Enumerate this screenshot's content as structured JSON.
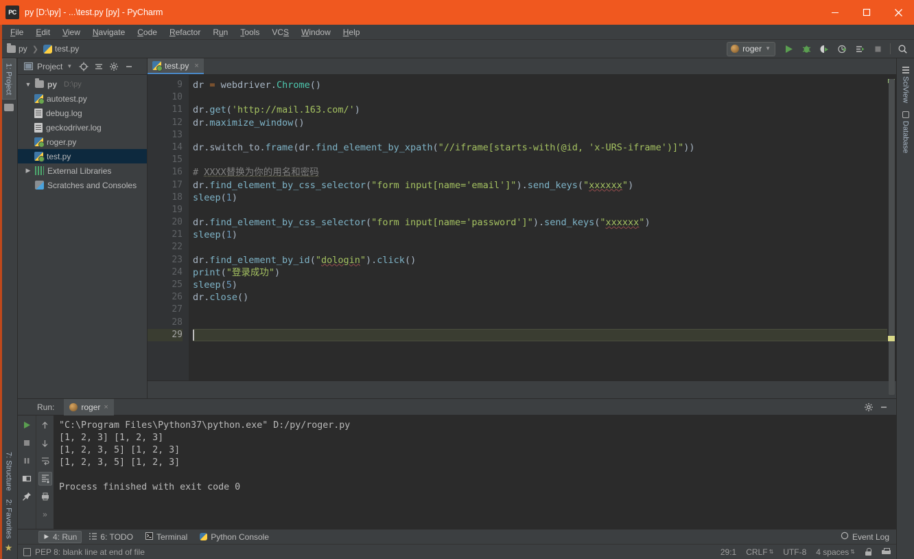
{
  "window": {
    "title": "py [D:\\py] - ...\\test.py [py] - PyCharm",
    "logo_text": "PC",
    "controls": {
      "minimize": "minimize-icon",
      "maximize": "maximize-icon",
      "close": "close-icon"
    }
  },
  "menubar": {
    "items": [
      "File",
      "Edit",
      "View",
      "Navigate",
      "Code",
      "Refactor",
      "Run",
      "Tools",
      "VCS",
      "Window",
      "Help"
    ]
  },
  "navbar": {
    "breadcrumb": [
      "py",
      "test.py"
    ],
    "run_config": "roger",
    "buttons": [
      "run-button",
      "debug-button",
      "run-coverage-button",
      "profile-button",
      "run-anything-button",
      "stop-button",
      "search-everywhere-button"
    ]
  },
  "left_rail": {
    "top": "1: Project",
    "bottom": [
      "7: Structure",
      "2: Favorites"
    ]
  },
  "right_rail": {
    "items": [
      "SciView",
      "Database"
    ]
  },
  "project_panel": {
    "title": "Project",
    "header_icons": [
      "locate-icon",
      "collapse-all-icon",
      "settings-icon",
      "hide-icon"
    ],
    "tree": [
      {
        "label": "py",
        "path": "D:\\py",
        "icon": "folder-icon",
        "twisty": "▼",
        "depth": 0,
        "selected": false
      },
      {
        "label": "autotest.py",
        "path": "",
        "icon": "python-file-icon",
        "twisty": "",
        "depth": 1,
        "selected": false
      },
      {
        "label": "debug.log",
        "path": "",
        "icon": "log-file-icon",
        "twisty": "",
        "depth": 1,
        "selected": false
      },
      {
        "label": "geckodriver.log",
        "path": "",
        "icon": "log-file-icon",
        "twisty": "",
        "depth": 1,
        "selected": false
      },
      {
        "label": "roger.py",
        "path": "",
        "icon": "python-file-icon",
        "twisty": "",
        "depth": 1,
        "selected": false
      },
      {
        "label": "test.py",
        "path": "",
        "icon": "python-file-icon",
        "twisty": "",
        "depth": 1,
        "selected": true
      },
      {
        "label": "External Libraries",
        "path": "",
        "icon": "libraries-icon",
        "twisty": "▶",
        "depth": 0,
        "selected": false
      },
      {
        "label": "Scratches and Consoles",
        "path": "",
        "icon": "scratches-icon",
        "twisty": "",
        "depth": 0,
        "selected": false
      }
    ]
  },
  "editor": {
    "tab": {
      "label": "test.py",
      "close": "×"
    },
    "first_line_number": 9,
    "caret_line": 29,
    "lines": [
      {
        "n": 9,
        "tokens": [
          {
            "t": "dr ",
            "c": "k-id"
          },
          {
            "t": "=",
            "c": "k-kw"
          },
          {
            "t": " webdriver.",
            "c": "k-id"
          },
          {
            "t": "Chrome",
            "c": "k-cls"
          },
          {
            "t": "()",
            "c": "k-op"
          }
        ]
      },
      {
        "n": 10,
        "tokens": []
      },
      {
        "n": 11,
        "tokens": [
          {
            "t": "dr.",
            "c": "k-id"
          },
          {
            "t": "get",
            "c": "k-fncall"
          },
          {
            "t": "(",
            "c": "k-op"
          },
          {
            "t": "'http://mail.163.com/'",
            "c": "k-str"
          },
          {
            "t": ")",
            "c": "k-op"
          }
        ]
      },
      {
        "n": 12,
        "tokens": [
          {
            "t": "dr.",
            "c": "k-id"
          },
          {
            "t": "maximize_window",
            "c": "k-fncall"
          },
          {
            "t": "()",
            "c": "k-op"
          }
        ]
      },
      {
        "n": 13,
        "tokens": []
      },
      {
        "n": 14,
        "tokens": [
          {
            "t": "dr.switch_to.",
            "c": "k-id"
          },
          {
            "t": "frame",
            "c": "k-fncall"
          },
          {
            "t": "(dr.",
            "c": "k-op"
          },
          {
            "t": "find_element_by_xpath",
            "c": "k-fncall"
          },
          {
            "t": "(",
            "c": "k-op"
          },
          {
            "t": "\"//iframe[starts-with(@id, 'x-URS-iframe')]\"",
            "c": "k-str"
          },
          {
            "t": "))",
            "c": "k-op"
          }
        ]
      },
      {
        "n": 15,
        "tokens": []
      },
      {
        "n": 16,
        "tokens": [
          {
            "t": "# ",
            "c": "k-cmt"
          },
          {
            "t": "XXXX替换为你的用名和密码",
            "c": "k-cmt cm-underline"
          }
        ]
      },
      {
        "n": 17,
        "tokens": [
          {
            "t": "dr.",
            "c": "k-id"
          },
          {
            "t": "find_element_by_css_selector",
            "c": "k-fncall"
          },
          {
            "t": "(",
            "c": "k-op"
          },
          {
            "t": "\"form input[name='email']\"",
            "c": "k-str"
          },
          {
            "t": ").",
            "c": "k-op"
          },
          {
            "t": "send_keys",
            "c": "k-fncall"
          },
          {
            "t": "(",
            "c": "k-op"
          },
          {
            "t": "\"",
            "c": "k-str"
          },
          {
            "t": "xxxxxx",
            "c": "k-str sp"
          },
          {
            "t": "\"",
            "c": "k-str"
          },
          {
            "t": ")",
            "c": "k-op"
          }
        ]
      },
      {
        "n": 18,
        "tokens": [
          {
            "t": "sleep",
            "c": "k-fncall"
          },
          {
            "t": "(",
            "c": "k-op"
          },
          {
            "t": "1",
            "c": "k-num"
          },
          {
            "t": ")",
            "c": "k-op"
          }
        ]
      },
      {
        "n": 19,
        "tokens": []
      },
      {
        "n": 20,
        "tokens": [
          {
            "t": "dr.",
            "c": "k-id"
          },
          {
            "t": "find_element_by_css_selector",
            "c": "k-fncall"
          },
          {
            "t": "(",
            "c": "k-op"
          },
          {
            "t": "\"form input[name='password']\"",
            "c": "k-str"
          },
          {
            "t": ").",
            "c": "k-op"
          },
          {
            "t": "send_keys",
            "c": "k-fncall"
          },
          {
            "t": "(",
            "c": "k-op"
          },
          {
            "t": "\"",
            "c": "k-str"
          },
          {
            "t": "xxxxxx",
            "c": "k-str sp"
          },
          {
            "t": "\"",
            "c": "k-str"
          },
          {
            "t": ")",
            "c": "k-op"
          }
        ]
      },
      {
        "n": 21,
        "tokens": [
          {
            "t": "sleep",
            "c": "k-fncall"
          },
          {
            "t": "(",
            "c": "k-op"
          },
          {
            "t": "1",
            "c": "k-num"
          },
          {
            "t": ")",
            "c": "k-op"
          }
        ]
      },
      {
        "n": 22,
        "tokens": []
      },
      {
        "n": 23,
        "tokens": [
          {
            "t": "dr.",
            "c": "k-id"
          },
          {
            "t": "find_element_by_id",
            "c": "k-fncall"
          },
          {
            "t": "(",
            "c": "k-op"
          },
          {
            "t": "\"",
            "c": "k-str"
          },
          {
            "t": "dologin",
            "c": "k-str sp"
          },
          {
            "t": "\"",
            "c": "k-str"
          },
          {
            "t": ").",
            "c": "k-op"
          },
          {
            "t": "click",
            "c": "k-fncall"
          },
          {
            "t": "()",
            "c": "k-op"
          }
        ]
      },
      {
        "n": 24,
        "tokens": [
          {
            "t": "print",
            "c": "k-fncall"
          },
          {
            "t": "(",
            "c": "k-op"
          },
          {
            "t": "\"登录成功\"",
            "c": "k-str"
          },
          {
            "t": ")",
            "c": "k-op"
          }
        ]
      },
      {
        "n": 25,
        "tokens": [
          {
            "t": "sleep",
            "c": "k-fncall"
          },
          {
            "t": "(",
            "c": "k-op"
          },
          {
            "t": "5",
            "c": "k-num"
          },
          {
            "t": ")",
            "c": "k-op"
          }
        ]
      },
      {
        "n": 26,
        "tokens": [
          {
            "t": "dr.",
            "c": "k-id"
          },
          {
            "t": "close",
            "c": "k-fncall"
          },
          {
            "t": "()",
            "c": "k-op"
          }
        ]
      },
      {
        "n": 27,
        "tokens": []
      },
      {
        "n": 28,
        "tokens": []
      },
      {
        "n": 29,
        "tokens": []
      }
    ]
  },
  "run_window": {
    "label": "Run:",
    "tab": "roger",
    "tab_close": "×",
    "header_icons": [
      "settings-icon",
      "hide-icon"
    ],
    "toolbar": [
      "rerun-button",
      "stop-button",
      "pause-button",
      "layout-button",
      "pin-button"
    ],
    "toolbar2": [
      "up-button",
      "down-button",
      "soft-wrap-button",
      "scroll-to-end-button",
      "print-button",
      "more-button"
    ],
    "console": "\"C:\\Program Files\\Python37\\python.exe\" D:/py/roger.py\n[1, 2, 3] [1, 2, 3]\n[1, 2, 3, 5] [1, 2, 3]\n[1, 2, 3, 5] [1, 2, 3]\n\nProcess finished with exit code 0"
  },
  "bottom_bar": {
    "items": [
      {
        "label": "4: Run",
        "icon": "play-icon",
        "active": true
      },
      {
        "label": "6: TODO",
        "icon": "todo-icon",
        "active": false
      },
      {
        "label": "Terminal",
        "icon": "terminal-icon",
        "active": false
      },
      {
        "label": "Python Console",
        "icon": "python-icon",
        "active": false
      }
    ],
    "event_log": "Event Log"
  },
  "status_bar": {
    "message": "PEP 8: blank line at end of file",
    "caret_position": "29:1",
    "line_separator": "CRLF",
    "encoding": "UTF-8",
    "indent": "4 spaces",
    "icons": [
      "lock-icon",
      "print-icon"
    ]
  },
  "colors": {
    "title_bar": "#f0581f",
    "chrome": "#3c3f41",
    "editor_bg": "#2b2b2b",
    "gutter_bg": "#313335",
    "selection": "#0d293e",
    "tab_underline": "#4a88c7",
    "string": "#a5c261",
    "number": "#6897bb",
    "comment": "#808080",
    "function": "#7fb5c9",
    "class": "#4ec9b0",
    "keyword": "#cc7832",
    "text": "#a9b7c6"
  }
}
